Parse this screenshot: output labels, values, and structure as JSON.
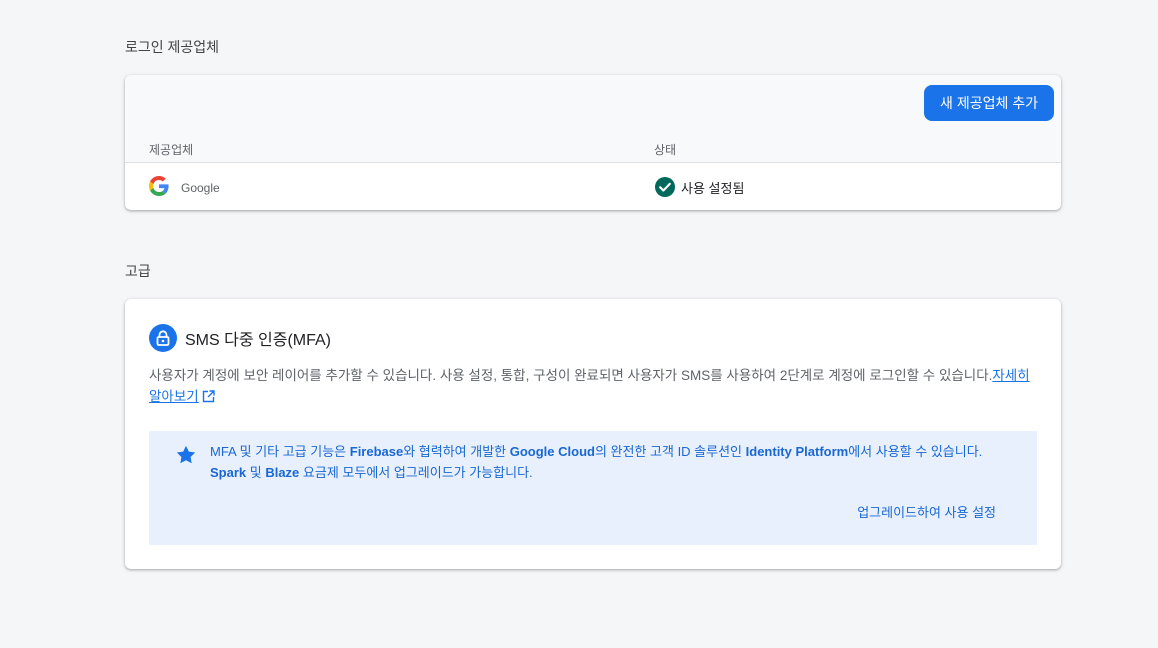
{
  "providers_section": {
    "title": "로그인 제공업체",
    "add_button": "새 제공업체 추가",
    "col_provider": "제공업체",
    "col_status": "상태",
    "rows": [
      {
        "name": "Google",
        "status": "사용 설정됨"
      }
    ]
  },
  "advanced_section": {
    "title": "고급",
    "mfa_title": "SMS 다중 인증(MFA)",
    "mfa_desc": "사용자가 계정에 보안 레이어를 추가할 수 있습니다. 사용 설정, 통합, 구성이 완료되면 사용자가 SMS를 사용하여 2단계로 계정에 로그인할 수 있습니다.",
    "learn_more": "자세히 알아보기",
    "promo": {
      "t1": "MFA 및 기타 고급 기능은 ",
      "b1": "Firebase",
      "t2": "와 협력하여 개발한 ",
      "b2": "Google Cloud",
      "t3": "의 완전한 고객 ID 솔루션인 ",
      "b3": "Identity Platform",
      "t4": "에서 사용할 수 있습니다. ",
      "b4": "Spark",
      "t5": " 및 ",
      "b5": "Blaze",
      "t6": " 요금제 모두에서 업그레이드가 가능합니다."
    },
    "upgrade_link": "업그레이드하여 사용 설정"
  },
  "colors": {
    "accent": "#1a73e8",
    "status_ok": "#00695c",
    "promo_bg": "#e8f0fe"
  },
  "icons": [
    "google-logo-icon",
    "check-circle-icon",
    "lock-icon",
    "external-link-icon",
    "star-icon"
  ]
}
